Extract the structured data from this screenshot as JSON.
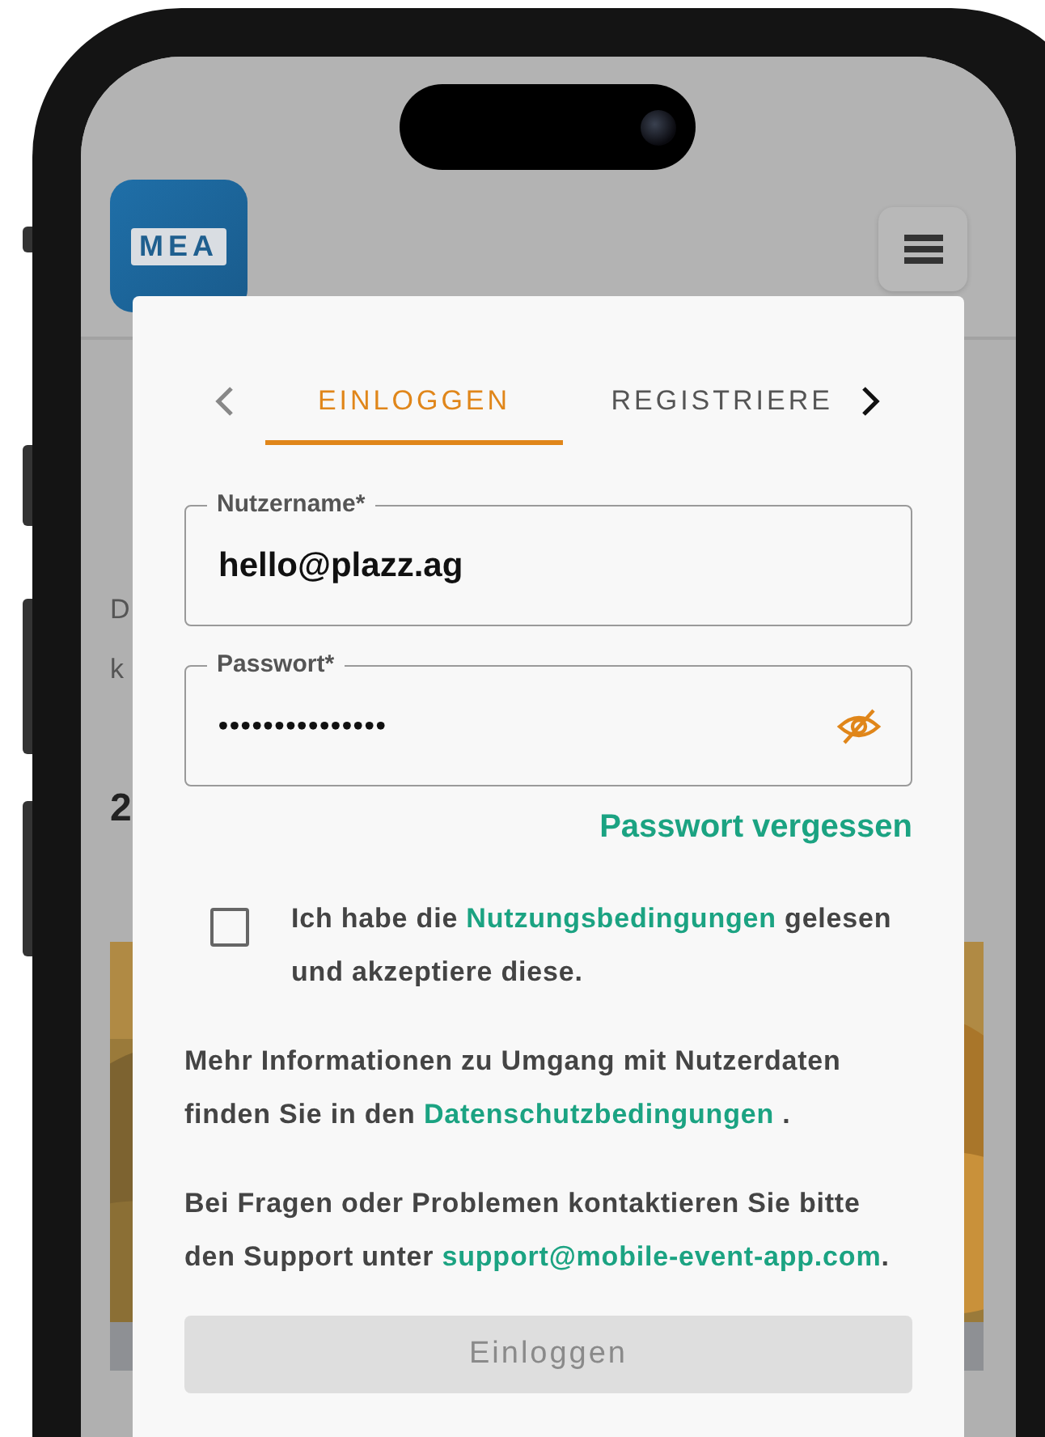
{
  "background_page": {
    "logo": "MEA",
    "fragments": [
      {
        "kind": "body",
        "text": "D"
      },
      {
        "kind": "body",
        "text": "k"
      },
      {
        "kind": "subheading",
        "text": "2"
      }
    ]
  },
  "login_dialog": {
    "tabs": [
      {
        "label": "EINLOGGEN",
        "selected": true
      },
      {
        "label": "REGISTRIERE",
        "selected": false
      }
    ],
    "fields": [
      {
        "kind": "text",
        "label": "Nutzername*",
        "value": "hello@plazz.ag"
      },
      {
        "kind": "password",
        "label": "Passwort*",
        "value": "•••••••••••••••"
      }
    ],
    "forgot_link": "Passwort vergessen",
    "terms": {
      "checked": false,
      "before": "Ich habe die ",
      "link": "Nutzungsbedingungen",
      "after": " gelesen und akzeptiere diese."
    },
    "privacy": {
      "before": "Mehr Informationen zu Umgang mit Nutzerdaten finden Sie in den ",
      "link": "Datenschutzbedingungen",
      "after": " ."
    },
    "support": {
      "before": "Bei Fragen oder Problemen kontaktieren Sie bitte den Support unter ",
      "link": "support@mobile-event-app.com",
      "after": "."
    },
    "submit": {
      "label": "Einloggen",
      "disabled": true
    }
  }
}
